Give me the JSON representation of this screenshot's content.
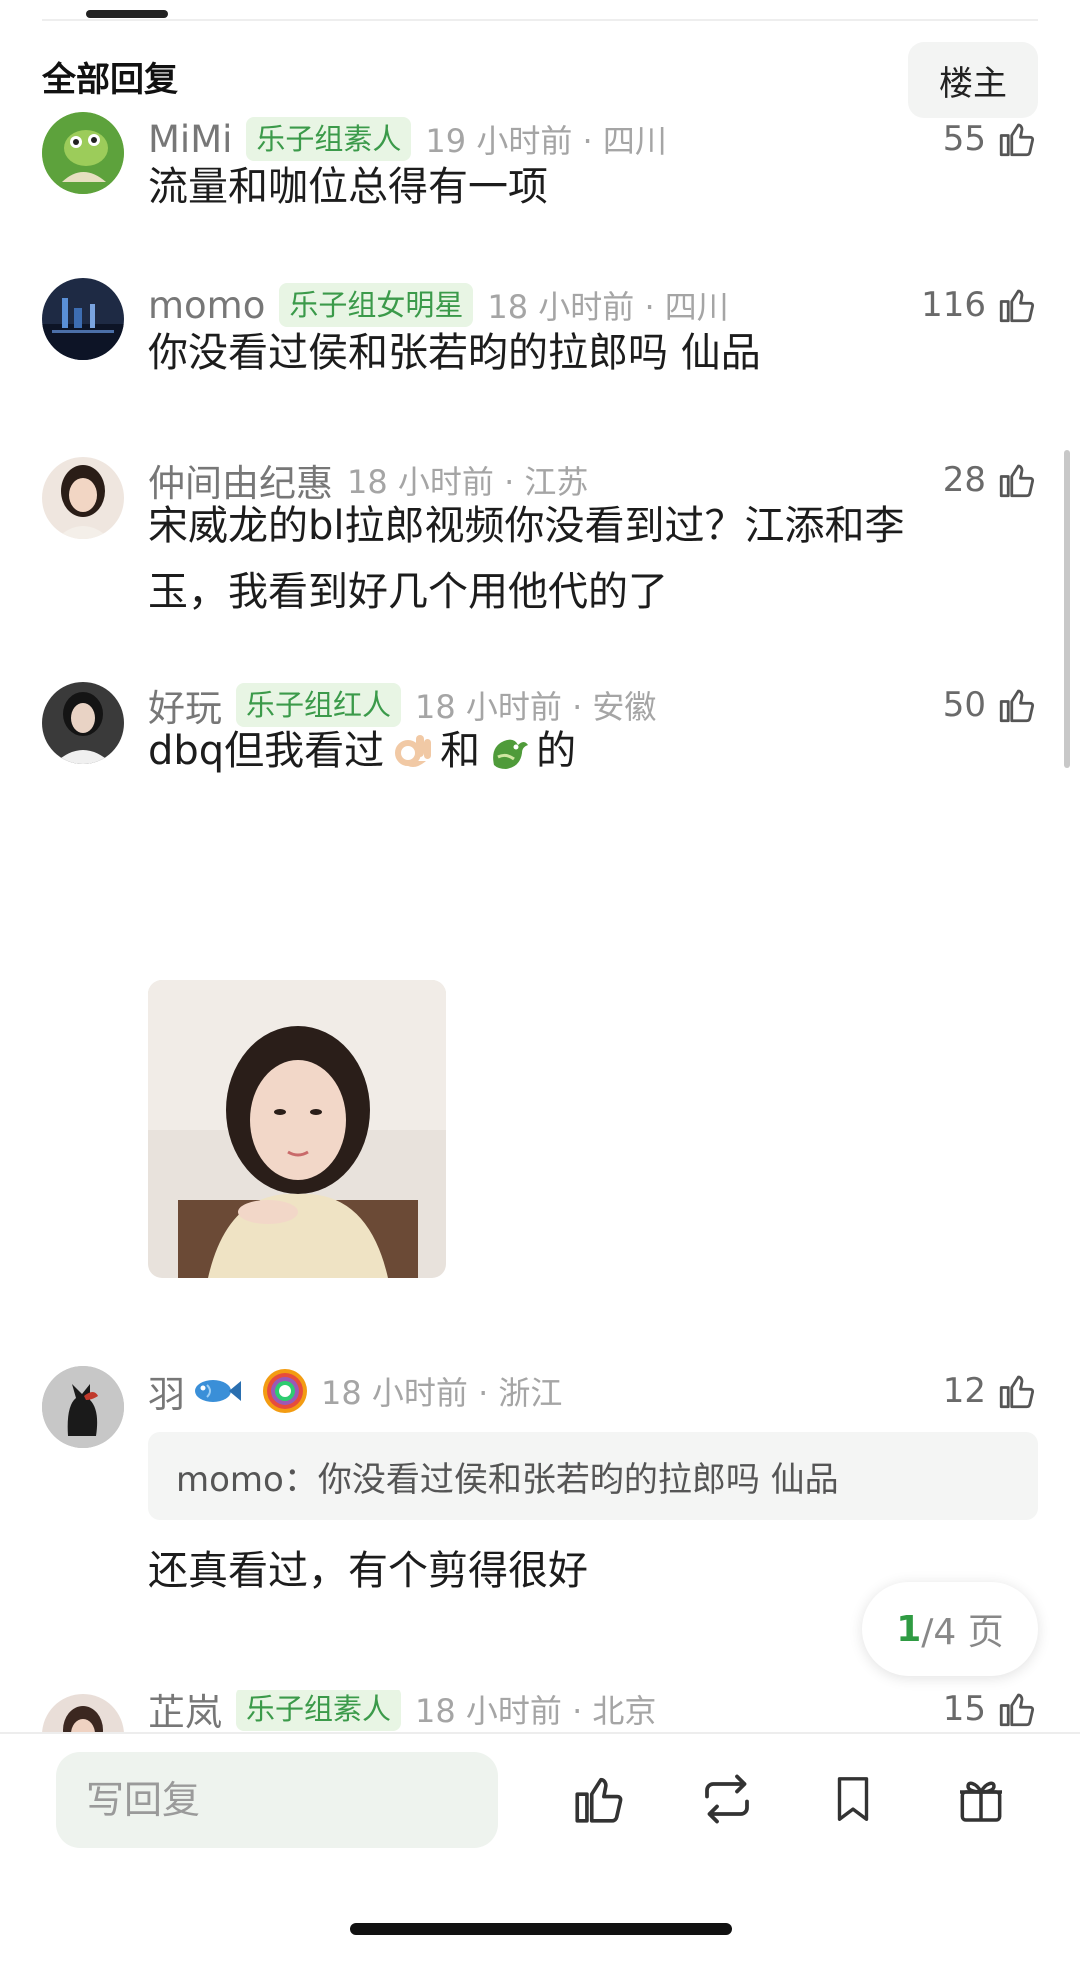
{
  "header": {
    "section_title": "全部回复",
    "owner_button": "楼主"
  },
  "comments": [
    {
      "username": "MiMi",
      "badge": "乐子组素人",
      "time_location": "19 小时前 · 四川",
      "likes": "55",
      "text": "流量和咖位总得有一项",
      "avatar": "frog-avatar"
    },
    {
      "username": "momo",
      "badge": "乐子组女明星",
      "time_location": "18 小时前 · 四川",
      "likes": "116",
      "text": "你没看过侯和张若昀的拉郎吗 仙品",
      "avatar": "city-night-avatar"
    },
    {
      "username": "仲间由纪惠",
      "time_location": "18 小时前 · 江苏",
      "likes": "28",
      "text_line1": "宋威龙的bl拉郎视频你没看到过？江添和李",
      "text_line2": "玉，我看到好几个用他代的了",
      "avatar": "girl-portrait-avatar"
    },
    {
      "username": "好玩",
      "badge": "乐子组红人",
      "time_location": "18 小时前 · 安徽",
      "likes": "50",
      "text_pre": "dbq但我看过",
      "text_mid": "和",
      "text_post": "的",
      "emoji_1": "ok-hand-emoji",
      "emoji_2": "dragon-emoji",
      "avatar": "woman-dark-avatar",
      "image": "portrait-photo"
    },
    {
      "username": "羽",
      "time_location": "18 小时前 · 浙江",
      "likes": "12",
      "quote": "momo：你没看过侯和张若昀的拉郎吗 仙品",
      "text": "还真看过，有个剪得很好",
      "avatar": "cat-avatar",
      "icons": [
        "fish-icon",
        "rainbow-badge-icon"
      ]
    },
    {
      "username": "芷岚",
      "badge": "乐子组素人",
      "time_location": "18 小时前 · 北京",
      "likes": "15",
      "avatar": "girl-avatar"
    }
  ],
  "pagination": {
    "current": "1",
    "total_label": "/4 页"
  },
  "bottom_bar": {
    "reply_placeholder": "写回复",
    "icons": [
      "thumbs-up-icon",
      "repost-icon",
      "bookmark-icon",
      "gift-icon"
    ]
  },
  "colors": {
    "badge_green": "#3b9a4a",
    "badge_bg": "#e8f5e4",
    "page_current": "#2f9b43"
  }
}
